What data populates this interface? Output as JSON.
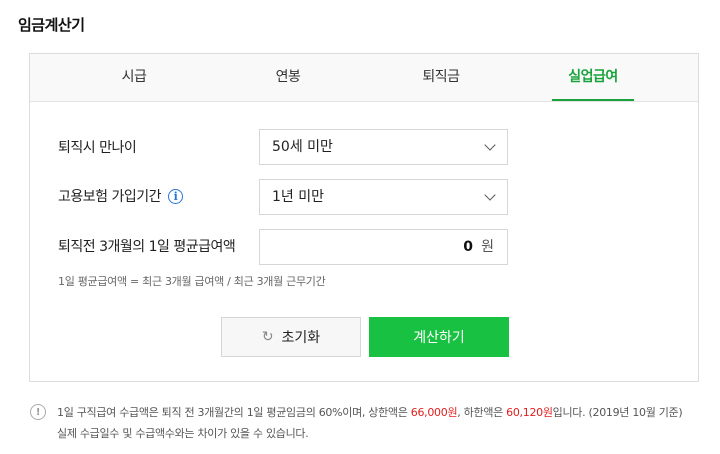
{
  "title": "임금계산기",
  "tabs": [
    {
      "label": "시급",
      "active": false
    },
    {
      "label": "연봉",
      "active": false
    },
    {
      "label": "퇴직금",
      "active": false
    },
    {
      "label": "실업급여",
      "active": true
    }
  ],
  "form": {
    "age_label": "퇴직시 만나이",
    "age_value": "50세 미만",
    "insurance_label": "고용보험 가입기간",
    "insurance_info_icon": "info-icon",
    "insurance_value": "1년 미만",
    "avg_wage_label": "퇴직전 3개월의 1일 평균급여액",
    "avg_wage_value": "0",
    "avg_wage_unit": "원",
    "formula": "1일 평균급여액 = 최근 3개월 급여액 / 최근 3개월 근무기간"
  },
  "buttons": {
    "reset_icon": "refresh-icon",
    "reset_label": "초기화",
    "calc_label": "계산하기"
  },
  "notice": {
    "icon": "exclamation-icon",
    "text1": "1일 구직급여 수급액은 퇴직 전 3개월간의 1일 평균임금의 60%이며, 상한액은 ",
    "upper_amount": "66,000원",
    "text2": ", 하한액은 ",
    "lower_amount": "60,120원",
    "text3": "입니다. (2019년 10월 기준) 실제 수급일수 및 수급액수와는 차이가 있을 수 있습니다."
  },
  "colors": {
    "accent": "#1aa33c",
    "button": "#19c142",
    "highlight": "#e02020",
    "info": "#2a74d8"
  }
}
